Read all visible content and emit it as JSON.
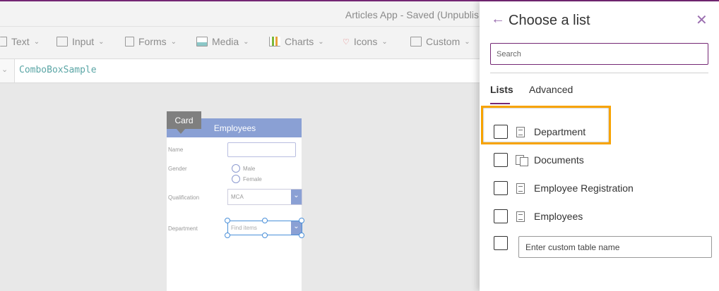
{
  "app": {
    "title": "Articles App - Saved (Unpublis",
    "formula_value": "ComboBoxSample"
  },
  "toolbar": [
    {
      "label": "Text",
      "icon": "text-icon"
    },
    {
      "label": "Input",
      "icon": "input-icon"
    },
    {
      "label": "Forms",
      "icon": "forms-icon"
    },
    {
      "label": "Media",
      "icon": "media-icon"
    },
    {
      "label": "Charts",
      "icon": "charts-icon"
    },
    {
      "label": "Icons",
      "icon": "icons-icon"
    },
    {
      "label": "Custom",
      "icon": "custom-icon"
    }
  ],
  "form": {
    "tag": "Card",
    "header": "Employees",
    "name_label": "Name",
    "gender_label": "Gender",
    "male": "Male",
    "female": "Female",
    "qualification_label": "Qualification",
    "qualification_value": "MCA",
    "department_label": "Department",
    "department_placeholder": "Find items"
  },
  "panel": {
    "title": "Choose a list",
    "search_placeholder": "Search",
    "tabs": [
      {
        "label": "Lists",
        "active": true
      },
      {
        "label": "Advanced",
        "active": false
      }
    ],
    "lists": [
      {
        "label": "Department",
        "icon": "list-icon",
        "highlighted": true
      },
      {
        "label": "Documents",
        "icon": "document-library-icon"
      },
      {
        "label": "Employee Registration",
        "icon": "list-icon"
      },
      {
        "label": "Employees",
        "icon": "list-icon"
      }
    ],
    "custom_placeholder": "Enter custom table name"
  },
  "colors": {
    "accent": "#742774",
    "highlight": "#f7a300",
    "form_header": "#8aa0d4"
  }
}
